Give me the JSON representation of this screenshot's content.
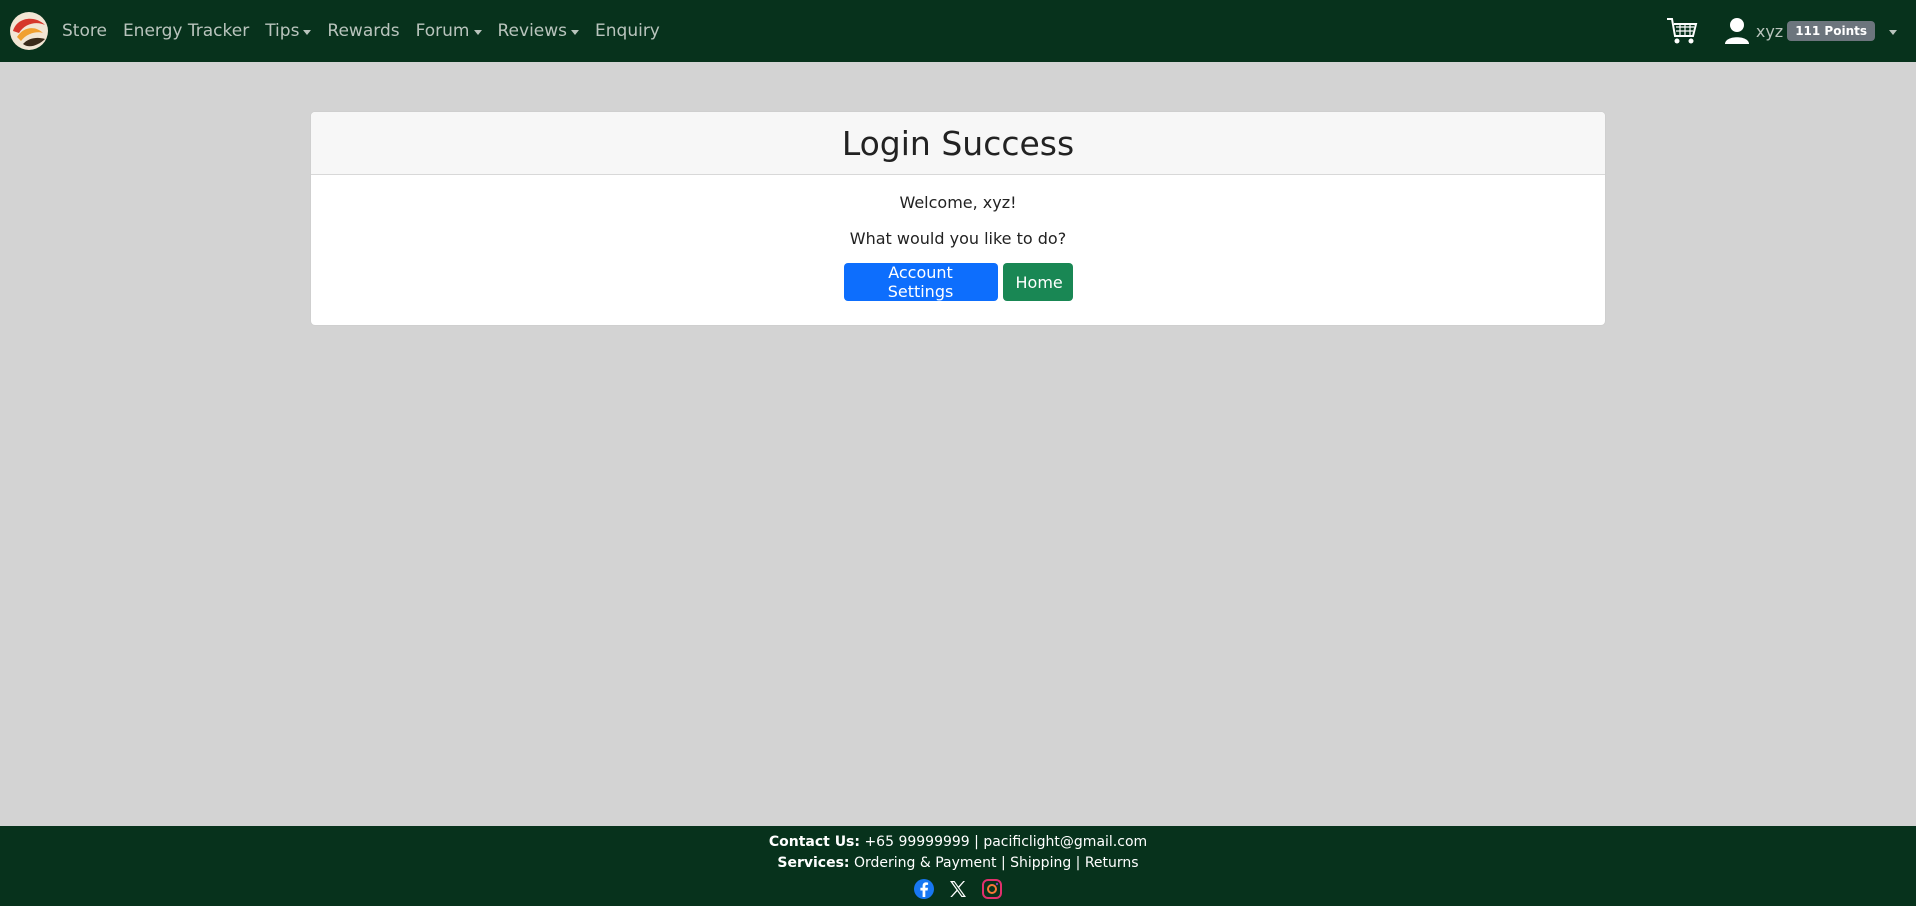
{
  "nav": {
    "links": [
      {
        "label": "Store",
        "dropdown": false
      },
      {
        "label": "Energy Tracker",
        "dropdown": false
      },
      {
        "label": "Tips",
        "dropdown": true
      },
      {
        "label": "Rewards",
        "dropdown": false
      },
      {
        "label": "Forum",
        "dropdown": true
      },
      {
        "label": "Reviews",
        "dropdown": true
      },
      {
        "label": "Enquiry",
        "dropdown": false
      }
    ],
    "username": "xyz",
    "points": "111 Points",
    "icons": {
      "logo": "brand-logo",
      "cart": "cart-icon",
      "user": "user-icon"
    }
  },
  "card": {
    "title": "Login Success",
    "welcome": "Welcome, xyz!",
    "question": "What would you like to do?",
    "account_settings_label": "Account Settings",
    "home_label": "Home"
  },
  "footer": {
    "contact_label": "Contact Us:",
    "contact_value": " +65 99999999 | pacificlight@gmail.com",
    "services_label": "Services:",
    "services_value": " Ordering & Payment | Shipping | Returns",
    "social": [
      "facebook-icon",
      "x-icon",
      "instagram-icon"
    ]
  },
  "colors": {
    "navbar_bg": "#07321c",
    "page_bg": "#d3d3d3",
    "primary": "#0d6efd",
    "success": "#198754",
    "badge": "#6c757d"
  }
}
